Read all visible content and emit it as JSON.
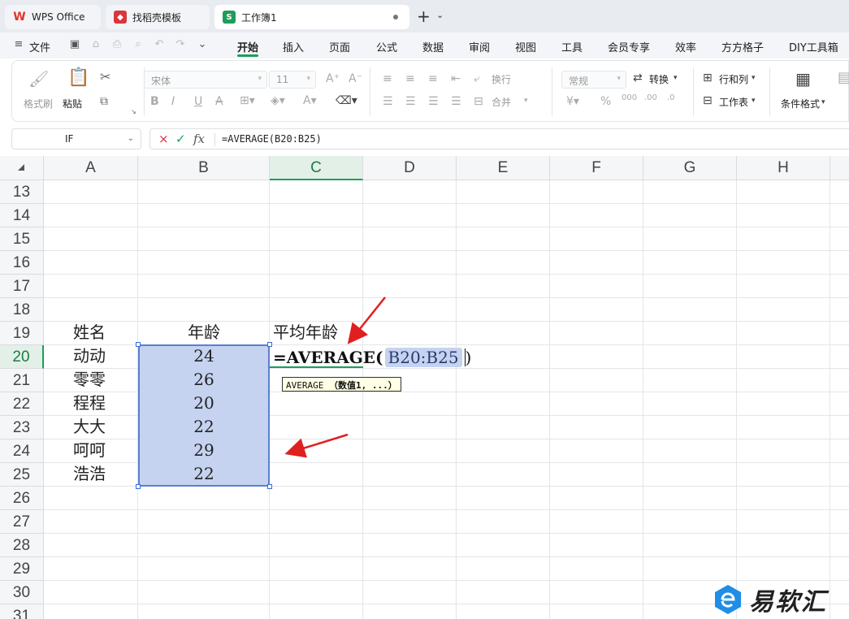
{
  "tabs": [
    {
      "label": "WPS Office",
      "icon": "wps-logo-icon"
    },
    {
      "label": "找稻壳模板",
      "icon": "docer-icon"
    },
    {
      "label": "工作簿1",
      "icon": "spreadsheet-icon",
      "active": true
    }
  ],
  "menu": {
    "file": "文件",
    "items": [
      "开始",
      "插入",
      "页面",
      "公式",
      "数据",
      "审阅",
      "视图",
      "工具",
      "会员专享",
      "效率",
      "方方格子",
      "DIY工具箱"
    ],
    "active": "开始"
  },
  "ribbon": {
    "format_painter": "格式刷",
    "paste": "粘贴",
    "font_name": "宋体",
    "font_size": "11",
    "wrap": "换行",
    "merge": "合并",
    "number_format": "常规",
    "convert": "转换",
    "row_col": "行和列",
    "worksheet": "工作表",
    "cond_format": "条件格式"
  },
  "formula_bar": {
    "name_box": "IF",
    "formula": "=AVERAGE(B20:B25)"
  },
  "columns": [
    "A",
    "B",
    "C",
    "D",
    "E",
    "F",
    "G",
    "H"
  ],
  "selected_column": "C",
  "rows": [
    "13",
    "14",
    "15",
    "16",
    "17",
    "18",
    "19",
    "20",
    "21",
    "22",
    "23",
    "24",
    "25",
    "26",
    "27",
    "28",
    "29",
    "30",
    "31"
  ],
  "selected_row": "20",
  "table": {
    "header_name": "姓名",
    "header_age": "年龄",
    "header_avg": "平均年龄",
    "names": [
      "动动",
      "零零",
      "程程",
      "大大",
      "呵呵",
      "浩浩"
    ],
    "ages": [
      "24",
      "26",
      "20",
      "22",
      "29",
      "22"
    ]
  },
  "editing": {
    "func": "=AVERAGE(",
    "arg": "B20:B25",
    "close": ")",
    "tooltip_func": "AVERAGE",
    "tooltip_args": "（数值1, ...）"
  },
  "watermark": "易软汇",
  "colors": {
    "accent": "#1e9d5a",
    "selection": "#c5d3f0",
    "arrow": "#e02020"
  }
}
